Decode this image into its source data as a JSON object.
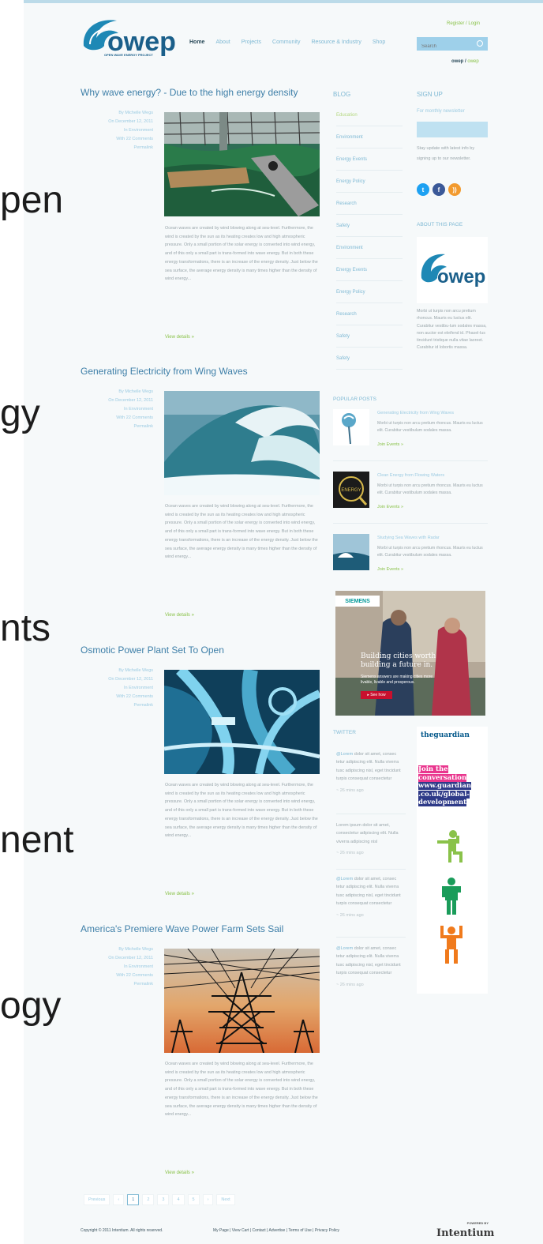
{
  "overlay_words": [
    "pen",
    "gy",
    "nts",
    "nent",
    "ogy"
  ],
  "header": {
    "logo_word": "owep",
    "logo_tagline": "OPEN WAVE ENERGY PROJECT",
    "nav": [
      "Home",
      "About",
      "Projects",
      "Community",
      "Resource & Industry",
      "Shop"
    ],
    "register_login": "Register / Login",
    "search_placeholder": "Search",
    "user": "owep",
    "user_sep": " / ",
    "user_action": "owep"
  },
  "articles": [
    {
      "title": "Why wave energy? - Due to the high energy density",
      "meta": [
        "By Michelle Wegs",
        "On December 12, 2011",
        "In Environment",
        "With 22 Comments",
        "Permalink"
      ],
      "excerpt": "Ocean waves are created by wind blowing along at sea-level. Furthermore, the wind is created by the sun as its heating creates low and high atmospheric pressure. Only a small portion of the solar energy is converted into wind energy, and of this only a small part is trans-formed into wave energy. But in both these energy transformations, there is an increase of the energy density. Just below the sea surface, the average energy density is many times higher than the density of wind energy...",
      "view_details": "View details »"
    },
    {
      "title": "Generating Electricity from Wing Waves",
      "meta": [
        "By Michelle Wegs",
        "On December 12, 2011",
        "In Environment",
        "With 22 Comments",
        "Permalink"
      ],
      "excerpt": "Ocean waves are created by wind blowing along at sea-level. Furthermore, the wind is created by the sun as its heating creates low and high atmospheric pressure. Only a small portion of the solar energy is converted into wind energy, and of this only a small part is trans-formed into wave energy. But in both these energy transformations, there is an increase of the energy density. Just below the sea surface, the average energy density is many times higher than the density of wind energy...",
      "view_details": "View details »"
    },
    {
      "title": "Osmotic Power Plant Set To Open",
      "meta": [
        "By Michelle Wegs",
        "On December 12, 2011",
        "In Environment",
        "With 22 Comments",
        "Permalink"
      ],
      "excerpt": "Ocean waves are created by wind blowing along at sea-level. Furthermore, the wind is created by the sun as its heating creates low and high atmospheric pressure. Only a small portion of the solar energy is converted into wind energy, and of this only a small part is trans-formed into wave energy. But in both these energy transformations, there is an increase of the energy density. Just below the sea surface, the average energy density is many times higher than the density of wind energy...",
      "view_details": "View details »"
    },
    {
      "title": "America's Premiere Wave Power Farm Sets Sail",
      "meta": [
        "By Michelle Wegs",
        "On December 12, 2011",
        "In Environment",
        "With 22 Comments",
        "Permalink"
      ],
      "excerpt": "Ocean waves are created by wind blowing along at sea-level. Furthermore, the wind is created by the sun as its heating creates low and high atmospheric pressure. Only a small portion of the solar energy is converted into wind energy, and of this only a small part is trans-formed into wave energy. But in both these energy transformations, there is an increase of the energy density. Just below the sea surface, the average energy density is many times higher than the density of wind energy...",
      "view_details": "View details »"
    }
  ],
  "blog": {
    "heading": "BLOG",
    "items": [
      "Education",
      "Environment",
      "Energy Events",
      "Energy Policy",
      "Research",
      "Safety",
      "Environment",
      "Energy Events",
      "Energy Policy",
      "Research",
      "Safety",
      "Safety"
    ]
  },
  "signup": {
    "heading": "SIGN UP",
    "sub": "For monthly newsletter",
    "desc": "Stay update with latest info by signing up to our newsletter."
  },
  "social_icons": [
    "twitter-icon",
    "facebook-icon",
    "rss-icon"
  ],
  "about": {
    "heading": "ABOUT THIS PAGE",
    "logo_word": "owep",
    "text": "Morbi ut turpis non arcu pretium rhoncus. Mauris eu luctus elit. Curabitur vestibu-lum sodales massa, non auctor est eleifend id. Phasel-lus tincidunt tristique nulla vitae laoreet. Curabitur id lobortis massa."
  },
  "popular": {
    "heading": "POPULAR POSTS",
    "posts": [
      {
        "title": "Generating Electricity from Wing Waves",
        "text": "Morbi ut turpis non arcu pretium rhoncus. Mauris eu luctus elit. Curabitur vestibulum sodales massa.",
        "more": "Join Events »"
      },
      {
        "title": "Clean Energy from Flowing Waters",
        "text": "Morbi ut turpis non arcu pretium rhoncus. Mauris eu luctus elit. Curabitur vestibulum sodales massa.",
        "more": "Join Events »"
      },
      {
        "title": "Studying Sea Waves with Radar",
        "text": "Morbi ut turpis non arcu pretium rhoncus. Mauris eu luctus elit. Curabitur vestibulum sodales massa.",
        "more": "Join Events »"
      }
    ]
  },
  "siemens_ad": {
    "brand": "SIEMENS",
    "headline_1": "Building cities worth",
    "headline_2": "building a future in.",
    "sub_1": "Siemens answers are making cities more",
    "sub_2": "livable, livable and prosperous.",
    "button": "▸ See how"
  },
  "twitter": {
    "heading": "TWITTER",
    "tweets": [
      {
        "link": "@Lorem",
        "text": " dolor sit amet, consec tetur adipiscing elit. Nulla viverra tusc adipiscing nisl, eget tincidunt turpis consequat consectetur",
        "time": "~ 26 mins ago"
      },
      {
        "link": "",
        "text": "Lorem ipsum dolor sit amet, consectetur adipiscing elit. Nulla viverra adipiscing nisl",
        "time": "~ 26 mins ago"
      },
      {
        "link": "@Lorem",
        "text": " dolor sit amet, consec tetur adipiscing elit. Nulla viverra tusc adipiscing nisl, eget tincidunt turpis consequat consectetur",
        "time": "~ 26 mins ago"
      },
      {
        "link": "@Lorem",
        "text": " dolor sit amet, consec tetur adipiscing elit. Nulla viverra tusc adipiscing nisl, eget tincidunt turpis consequat consectetur",
        "time": "~ 26 mins ago"
      }
    ]
  },
  "guardian_ad": {
    "logo": "theguardian",
    "join_1": "Join the conversation",
    "join_2": "www.guardian .co.uk/global-development"
  },
  "pagination": [
    "Previous",
    "‹",
    "1",
    "2",
    "3",
    "4",
    "5",
    "›",
    "Next"
  ],
  "footer": {
    "copyright": "Copyright © 2011 Intentium. All rights reserved.",
    "links": "My Page | View Cart | Contact | Advertise | Terms of Use | Privacy Policy",
    "powered_by": "POWERED BY",
    "brand": "Intentium"
  },
  "colors": {
    "accent_blue": "#3e7fa8",
    "light_blue": "#7fb9d4",
    "green": "#8ac24a",
    "twitter": "#1da1f2",
    "facebook": "#3b5998",
    "rss": "#f29a2e"
  }
}
